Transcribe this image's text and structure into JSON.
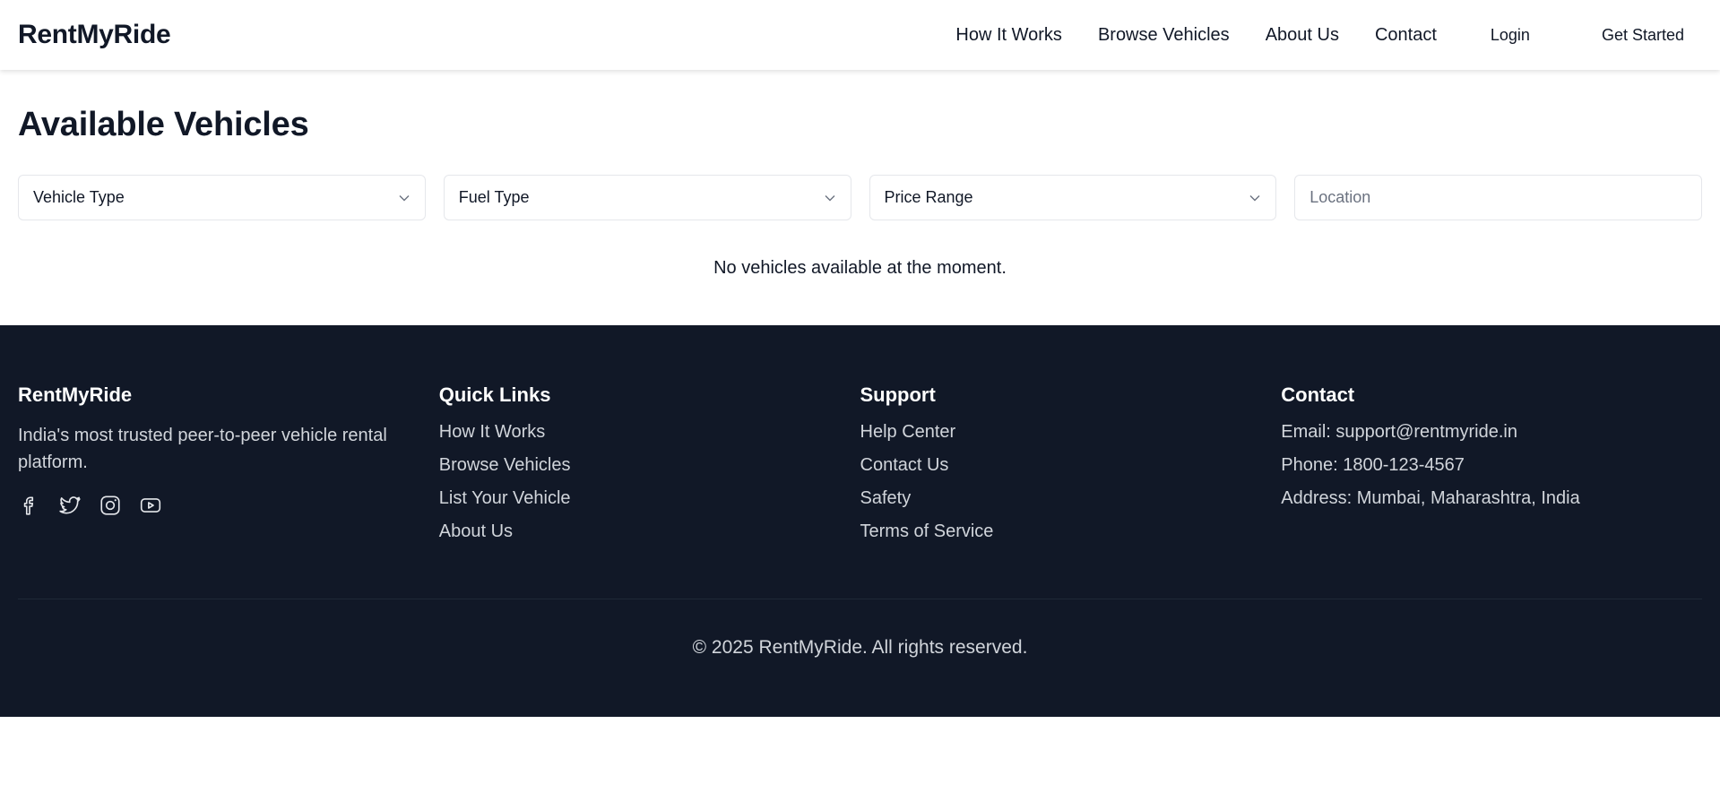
{
  "header": {
    "brand": "RentMyRide",
    "nav": [
      {
        "label": "How It Works"
      },
      {
        "label": "Browse Vehicles"
      },
      {
        "label": "About Us"
      },
      {
        "label": "Contact"
      }
    ],
    "login": "Login",
    "get_started": "Get Started"
  },
  "main": {
    "title": "Available Vehicles",
    "filters": {
      "vehicle_type": "Vehicle Type",
      "fuel_type": "Fuel Type",
      "price_range": "Price Range",
      "location_placeholder": "Location"
    },
    "empty_message": "No vehicles available at the moment."
  },
  "footer": {
    "about": {
      "title": "RentMyRide",
      "tagline": "India's most trusted peer-to-peer vehicle rental platform.",
      "socials": [
        "facebook-icon",
        "twitter-icon",
        "instagram-icon",
        "youtube-icon"
      ]
    },
    "quick_links": {
      "title": "Quick Links",
      "items": [
        "How It Works",
        "Browse Vehicles",
        "List Your Vehicle",
        "About Us"
      ]
    },
    "support": {
      "title": "Support",
      "items": [
        "Help Center",
        "Contact Us",
        "Safety",
        "Terms of Service"
      ]
    },
    "contact": {
      "title": "Contact",
      "email": "Email: support@rentmyride.in",
      "phone": "Phone: 1800-123-4567",
      "address": "Address: Mumbai, Maharashtra, India"
    },
    "copyright": "© 2025 RentMyRide. All rights reserved."
  },
  "colors": {
    "footer_bg": "#111827",
    "text_dark": "#111827",
    "text_muted": "#6b7280",
    "border": "#e5e7eb"
  }
}
